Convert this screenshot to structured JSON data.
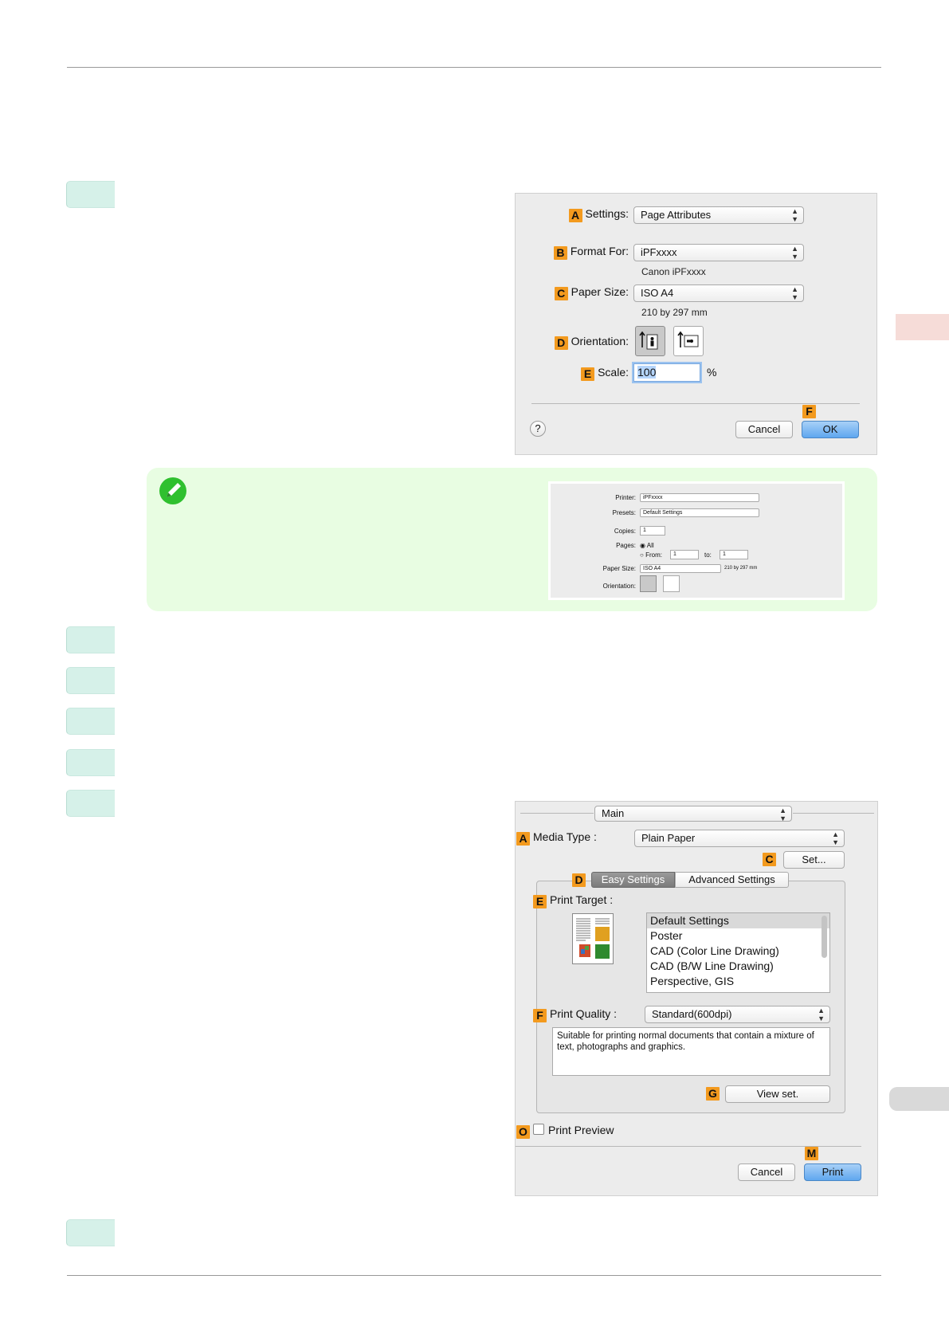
{
  "dialog1": {
    "settings": {
      "badge": "A",
      "label": "Settings:",
      "value": "Page Attributes"
    },
    "format_for": {
      "badge": "B",
      "label": "Format For:",
      "value": "iPFxxxx",
      "sub": "Canon iPFxxxx"
    },
    "paper_size": {
      "badge": "C",
      "label": "Paper Size:",
      "value": "ISO A4",
      "sub": "210 by 297 mm"
    },
    "orientation": {
      "badge": "D",
      "label": "Orientation:"
    },
    "scale": {
      "badge": "E",
      "label": "Scale:",
      "value": "100",
      "unit": "%"
    },
    "help": "?",
    "cancel": "Cancel",
    "ok_badge": "F",
    "ok": "OK"
  },
  "note_dialog": {
    "printer_label": "Printer:",
    "printer_value": "iPFxxxx",
    "presets_label": "Presets:",
    "presets_value": "Default Settings",
    "copies_label": "Copies:",
    "copies_value": "1",
    "pages_label": "Pages:",
    "all_label": "All",
    "from_label": "From:",
    "from_value": "1",
    "to_label": "to:",
    "to_value": "1",
    "paper_label": "Paper Size:",
    "paper_value": "ISO A4",
    "paper_sub": "210 by 297 mm",
    "orientation_label": "Orientation:"
  },
  "dialog2": {
    "main": "Main",
    "media_type": {
      "badge": "A",
      "label": "Media Type :",
      "value": "Plain Paper"
    },
    "set": {
      "badge": "C",
      "label": "Set..."
    },
    "tabs": {
      "badge": "D",
      "easy": "Easy Settings",
      "advanced": "Advanced Settings"
    },
    "print_target": {
      "badge": "E",
      "label": "Print Target :"
    },
    "targets": [
      "Default Settings",
      "Poster",
      "CAD (Color Line Drawing)",
      "CAD (B/W Line Drawing)",
      "Perspective, GIS"
    ],
    "print_quality": {
      "badge": "F",
      "label": "Print Quality :",
      "value": "Standard(600dpi)"
    },
    "description": "Suitable for printing normal documents that contain a mixture of text, photographs and graphics.",
    "view_set": {
      "badge": "G",
      "label": "View set."
    },
    "preview": {
      "badge": "O",
      "label": "Print Preview"
    },
    "cancel": "Cancel",
    "print_badge": "M",
    "print": "Print"
  },
  "colors": {
    "accent_badge": "#f39a1e",
    "step_tab": "#d6f1e9",
    "note_bg": "#e8fde2",
    "side_tab": "#f6dcd8"
  }
}
